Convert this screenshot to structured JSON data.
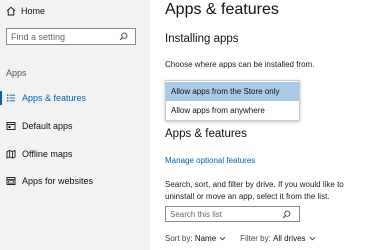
{
  "sidebar": {
    "home_label": "Home",
    "search_placeholder": "Find a setting",
    "section_label": "Apps",
    "items": [
      {
        "label": "Apps & features",
        "icon": "apps-list-icon"
      },
      {
        "label": "Default apps",
        "icon": "default-apps-icon"
      },
      {
        "label": "Offline maps",
        "icon": "map-icon"
      },
      {
        "label": "Apps for websites",
        "icon": "web-apps-icon"
      }
    ]
  },
  "main": {
    "title": "Apps & features",
    "installing_heading": "Installing apps",
    "installing_text": "Choose where apps can be installed from.",
    "dropdown_options": [
      "Allow apps from the Store only",
      "Allow apps from anywhere"
    ],
    "features_heading": "Apps & features",
    "manage_link": "Manage optional features",
    "description": "Search, sort, and filter by drive. If you would like to uninstall or move an app, select it from the list.",
    "list_search_placeholder": "Search this list",
    "sort_label": "Sort by:",
    "sort_value": "Name",
    "filter_label": "Filter by:",
    "filter_value": "All drives"
  },
  "colors": {
    "accent": "#0063b1",
    "sidebar_bg": "#f2f2f2",
    "selected_option_bg": "#a9cbe8"
  }
}
